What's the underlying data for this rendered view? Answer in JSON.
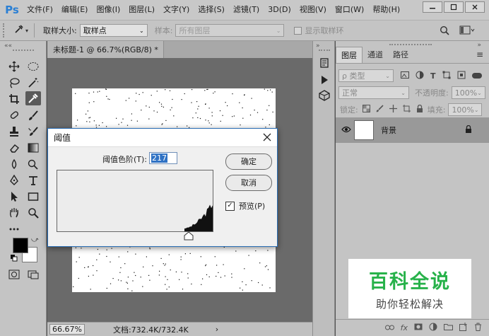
{
  "app": {
    "logo": "Ps",
    "menu": [
      "文件(F)",
      "编辑(E)",
      "图像(I)",
      "图层(L)",
      "文字(Y)",
      "选择(S)",
      "滤镜(T)",
      "3D(D)",
      "视图(V)",
      "窗口(W)",
      "帮助(H)"
    ]
  },
  "options": {
    "sample_size_label": "取样大小:",
    "sample_size_value": "取样点",
    "sample_label": "样本:",
    "sample_value": "所有图层",
    "show_ring_label": "显示取样环"
  },
  "document": {
    "tab_title": "未标题-1 @ 66.7%(RGB/8) *",
    "tab_close": "×"
  },
  "status": {
    "zoom": "66.67%",
    "doc_size": "文档:732.4K/732.4K",
    "arrow": "›"
  },
  "layers_panel": {
    "tabs": [
      "图层",
      "通道",
      "路径"
    ],
    "kind_label": "ρ 类型",
    "blend_mode": "正常",
    "opacity_label": "不透明度:",
    "opacity_value": "100%",
    "lock_label": "锁定:",
    "fill_label": "填充:",
    "fill_value": "100%",
    "layer_name": "背景"
  },
  "dialog": {
    "title": "阈值",
    "level_label": "阈值色阶(T):",
    "level_value": "217",
    "ok_label": "确定",
    "cancel_label": "取消",
    "preview_label": "预览(P)",
    "preview_checked": true
  },
  "watermark": {
    "title": "百科全说",
    "subtitle": "助你轻松解决"
  },
  "colors": {
    "accent": "#2a6db5",
    "watermark_green": "#27b24a"
  }
}
